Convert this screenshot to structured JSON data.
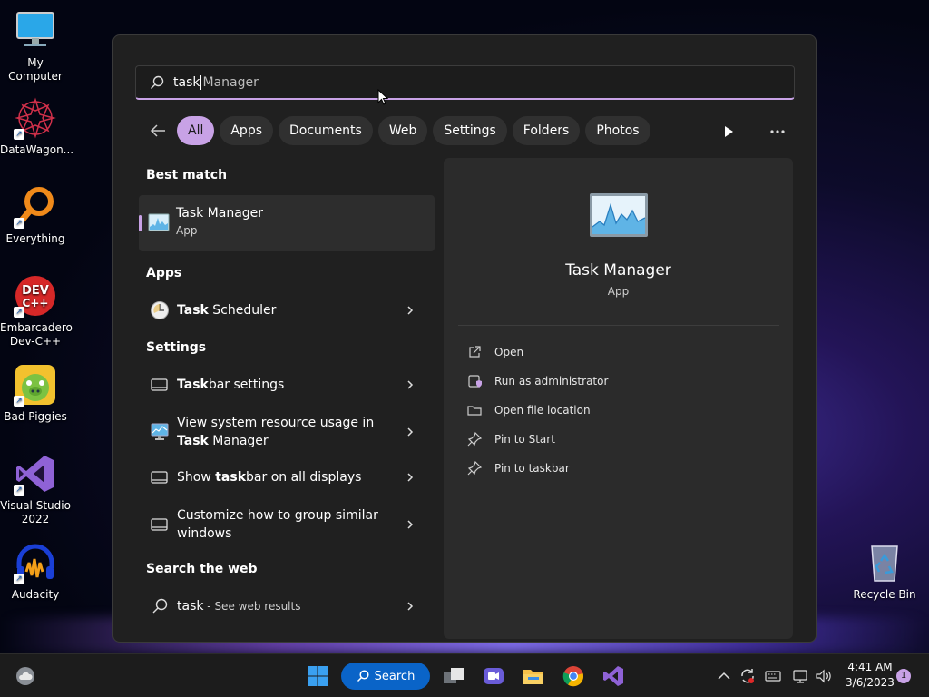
{
  "desktop_icons": [
    {
      "label": "My Computer"
    },
    {
      "label": "DataWagon..."
    },
    {
      "label": "Everything"
    },
    {
      "label": "Embarcadero Dev-C++"
    },
    {
      "label": "Bad Piggies"
    },
    {
      "label": "Visual Studio 2022"
    },
    {
      "label": "Audacity"
    },
    {
      "label": "Recycle Bin"
    }
  ],
  "search": {
    "typed": "task",
    "completion": " Manager"
  },
  "filters": [
    "All",
    "Apps",
    "Documents",
    "Web",
    "Settings",
    "Folders",
    "Photos"
  ],
  "sections": {
    "best_match": "Best match",
    "apps": "Apps",
    "settings": "Settings",
    "search_web": "Search the web"
  },
  "best_match": {
    "name": "Task Manager",
    "type": "App"
  },
  "apps": [
    {
      "bold": "Task",
      "rest": " Scheduler"
    }
  ],
  "settings_items": [
    {
      "line1_bold": "Task",
      "line1_rest": "bar settings",
      "line2": ""
    },
    {
      "line1_bold": "",
      "line1_rest": "View system resource usage in",
      "line2_bold": "Task",
      "line2_rest": " Manager"
    },
    {
      "line1_bold": "",
      "line1_rest": "Show ",
      "mid_bold": "task",
      "tail": "bar on all displays"
    },
    {
      "line1_rest": "Customize how to group similar",
      "line2": "windows"
    }
  ],
  "web_result": {
    "query": "task",
    "suffix": " - See web results"
  },
  "detail": {
    "name": "Task Manager",
    "type": "App",
    "actions": [
      "Open",
      "Run as administrator",
      "Open file location",
      "Pin to Start",
      "Pin to taskbar"
    ]
  },
  "taskbar": {
    "search_label": "Search",
    "time": "4:41 AM",
    "date": "3/6/2023",
    "notification_count": "1"
  },
  "colors": {
    "accent": "#c8a2e6",
    "search_button": "#0a64c8",
    "panel": "#202020"
  }
}
